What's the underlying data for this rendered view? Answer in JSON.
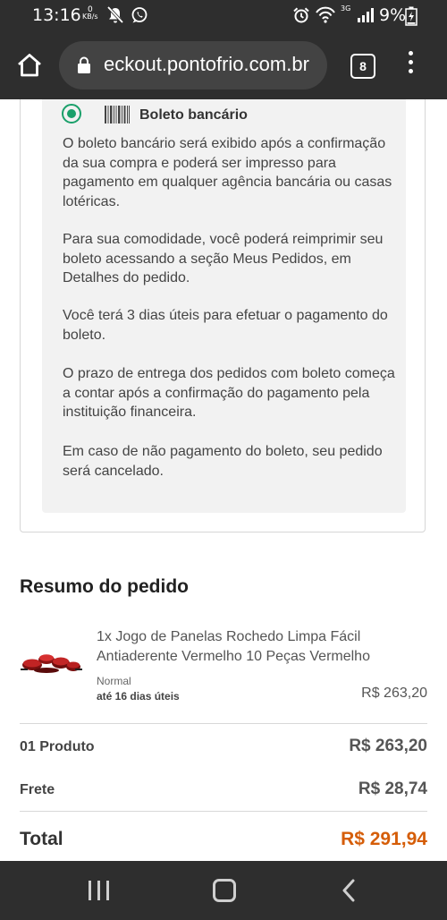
{
  "status_bar": {
    "time": "13:16",
    "kbs_value": "0",
    "kbs_unit": "KB/s",
    "network_label": "3G",
    "battery_percent": "9%"
  },
  "browser": {
    "url": "eckout.pontofrio.com.br",
    "tab_count": "8"
  },
  "payment": {
    "option_label": "Boleto bancário",
    "selected": true,
    "paragraphs": [
      "O boleto bancário será exibido após a confirmação da sua compra e poderá ser impresso para pagamento em qualquer agência bancária ou casas lotéricas.",
      "Para sua comodidade, você poderá reimprimir seu boleto acessando a seção Meus Pedidos, em Detalhes do pedido.",
      "Você terá 3 dias úteis para efetuar o pagamento do boleto.",
      "O prazo de entrega dos pedidos com boleto começa a contar após a confirmação do pagamento pela instituição financeira.",
      "Em caso de não pagamento do boleto, seu pedido será cancelado."
    ]
  },
  "summary": {
    "title": "Resumo do pedido",
    "item": {
      "name": "1x Jogo de Panelas Rochedo Limpa Fácil Antiaderente Vermelho 10 Peças Vermelho",
      "shipping_type": "Normal",
      "shipping_time": "até 16 dias úteis",
      "price": "R$ 263,20"
    },
    "products_label": "01 Produto",
    "products_value": "R$ 263,20",
    "shipping_label": "Frete",
    "shipping_value": "R$ 28,74",
    "total_label": "Total",
    "total_value": "R$ 291,94"
  },
  "colors": {
    "system_bars": "#2e2e2e",
    "radio_green": "#1aa06a",
    "total_orange": "#d55d08"
  },
  "icons": {
    "status_left": [
      "bell-off-icon",
      "whatsapp-icon"
    ],
    "status_right": [
      "alarm-icon",
      "wifi-icon",
      "signal-icon",
      "battery-icon"
    ],
    "browser": [
      "home-icon",
      "lock-icon",
      "tabs-icon",
      "more-vert-icon"
    ],
    "payment": "barcode-icon",
    "nav": [
      "recents-icon",
      "home-circle-icon",
      "back-icon"
    ]
  }
}
